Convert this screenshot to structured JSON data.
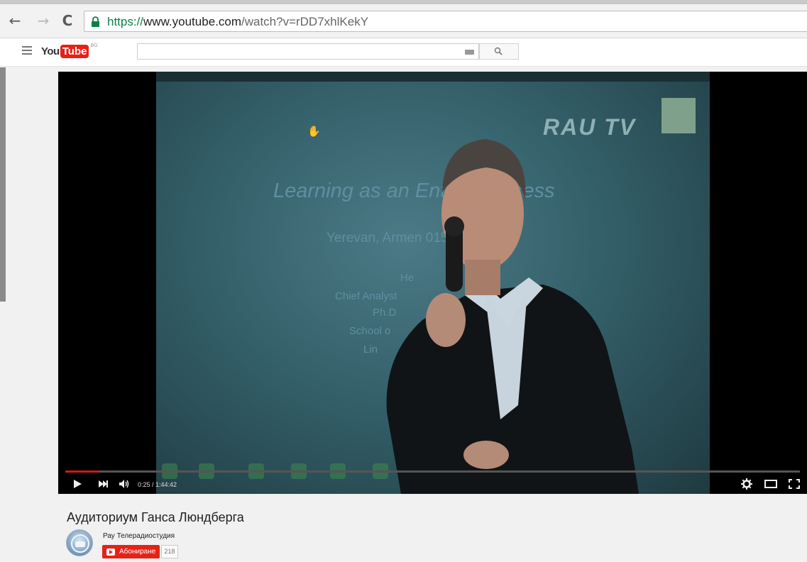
{
  "browser": {
    "url_scheme": "https://",
    "url_host": "www.youtube.com",
    "url_path": "/watch?v=rDD7xhlKekY"
  },
  "header": {
    "logo_you": "You",
    "logo_tube": "Tube",
    "logo_country": "BG",
    "search_placeholder": ""
  },
  "video": {
    "slide": {
      "rau_logo": "RAU TV",
      "title": "Learning as an Entr            al Process",
      "subtitle": "Yerevan, Armen                015",
      "name": "He",
      "role": "Chief Analyst",
      "degree": "Ph.D",
      "school": "School o",
      "city": "Lin"
    },
    "time_display": "0:25 / 1:44:42",
    "progress_fraction": 0.004
  },
  "info": {
    "title": "Аудиториум Ганса Люндберга",
    "channel_name": "Рау Телерадиостудия",
    "subscribe_label": "Абониране",
    "subscriber_count": "218"
  },
  "colors": {
    "accent": "#e62117",
    "progress": "#cc181e"
  },
  "icons": [
    "back-icon",
    "forward-icon",
    "reload-icon",
    "lock-icon",
    "menu-icon",
    "keyboard-icon",
    "search-icon",
    "play-icon",
    "next-icon",
    "volume-icon",
    "settings-icon",
    "theater-icon",
    "fullscreen-icon"
  ]
}
